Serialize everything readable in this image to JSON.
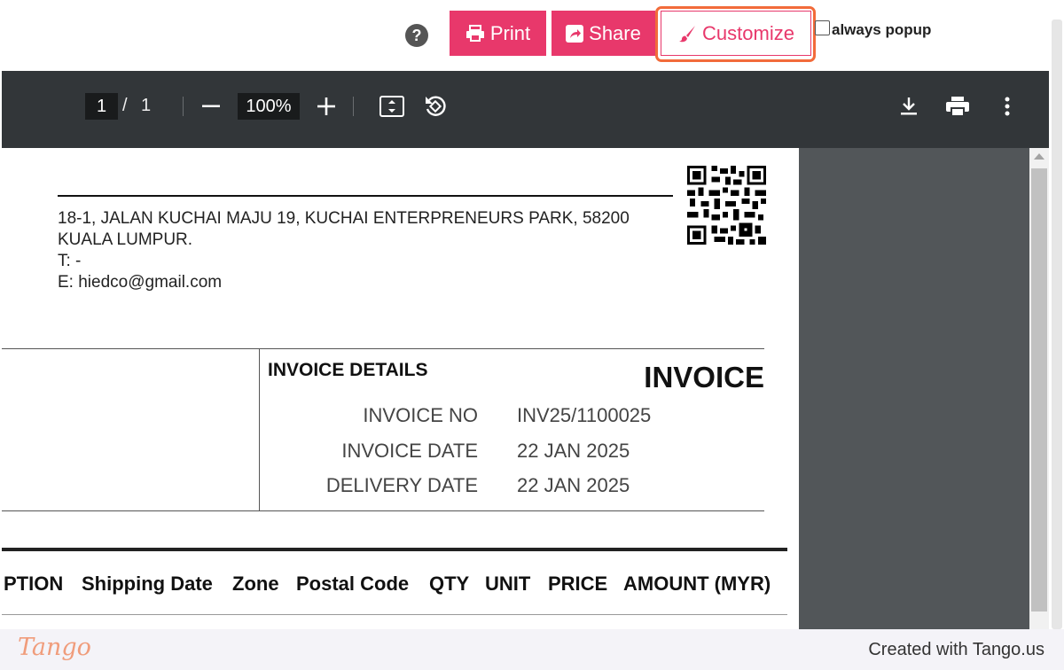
{
  "topbar": {
    "help_symbol": "?",
    "print_label": "Print",
    "share_label": "Share",
    "customize_label": "Customize",
    "always_popup_label": "always popup",
    "accent_color": "#e8386b",
    "highlight_color": "#f26b3a"
  },
  "pdf_toolbar": {
    "current_page": "1",
    "page_separator": "/",
    "total_pages": "1",
    "zoom_out_symbol": "—",
    "zoom_level": "100%",
    "zoom_in_symbol": "+",
    "icons": [
      "fit-page-icon",
      "rotate-icon",
      "download-icon",
      "print-icon",
      "more-vert-icon"
    ]
  },
  "document": {
    "address_line1": "18-1, JALAN KUCHAI MAJU 19, KUCHAI ENTERPRENEURS PARK, 58200",
    "address_line2": "KUALA LUMPUR.",
    "phone": "T: -",
    "email": "E: hiedco@gmail.com",
    "invoice_details_heading": "INVOICE DETAILS",
    "invoice_title": "INVOICE",
    "fields": [
      {
        "label": "INVOICE NO",
        "value": "INV25/1100025"
      },
      {
        "label": "INVOICE DATE",
        "value": "22 JAN 2025"
      },
      {
        "label": "DELIVERY DATE",
        "value": "22 JAN 2025"
      }
    ],
    "table_headers": [
      "PTION",
      "Shipping Date",
      "Zone",
      "Postal Code",
      "QTY",
      "UNIT",
      "PRICE",
      "AMOUNT (MYR)"
    ]
  },
  "footer": {
    "logo_text": "Tango",
    "created_text": "Created with Tango.us"
  }
}
